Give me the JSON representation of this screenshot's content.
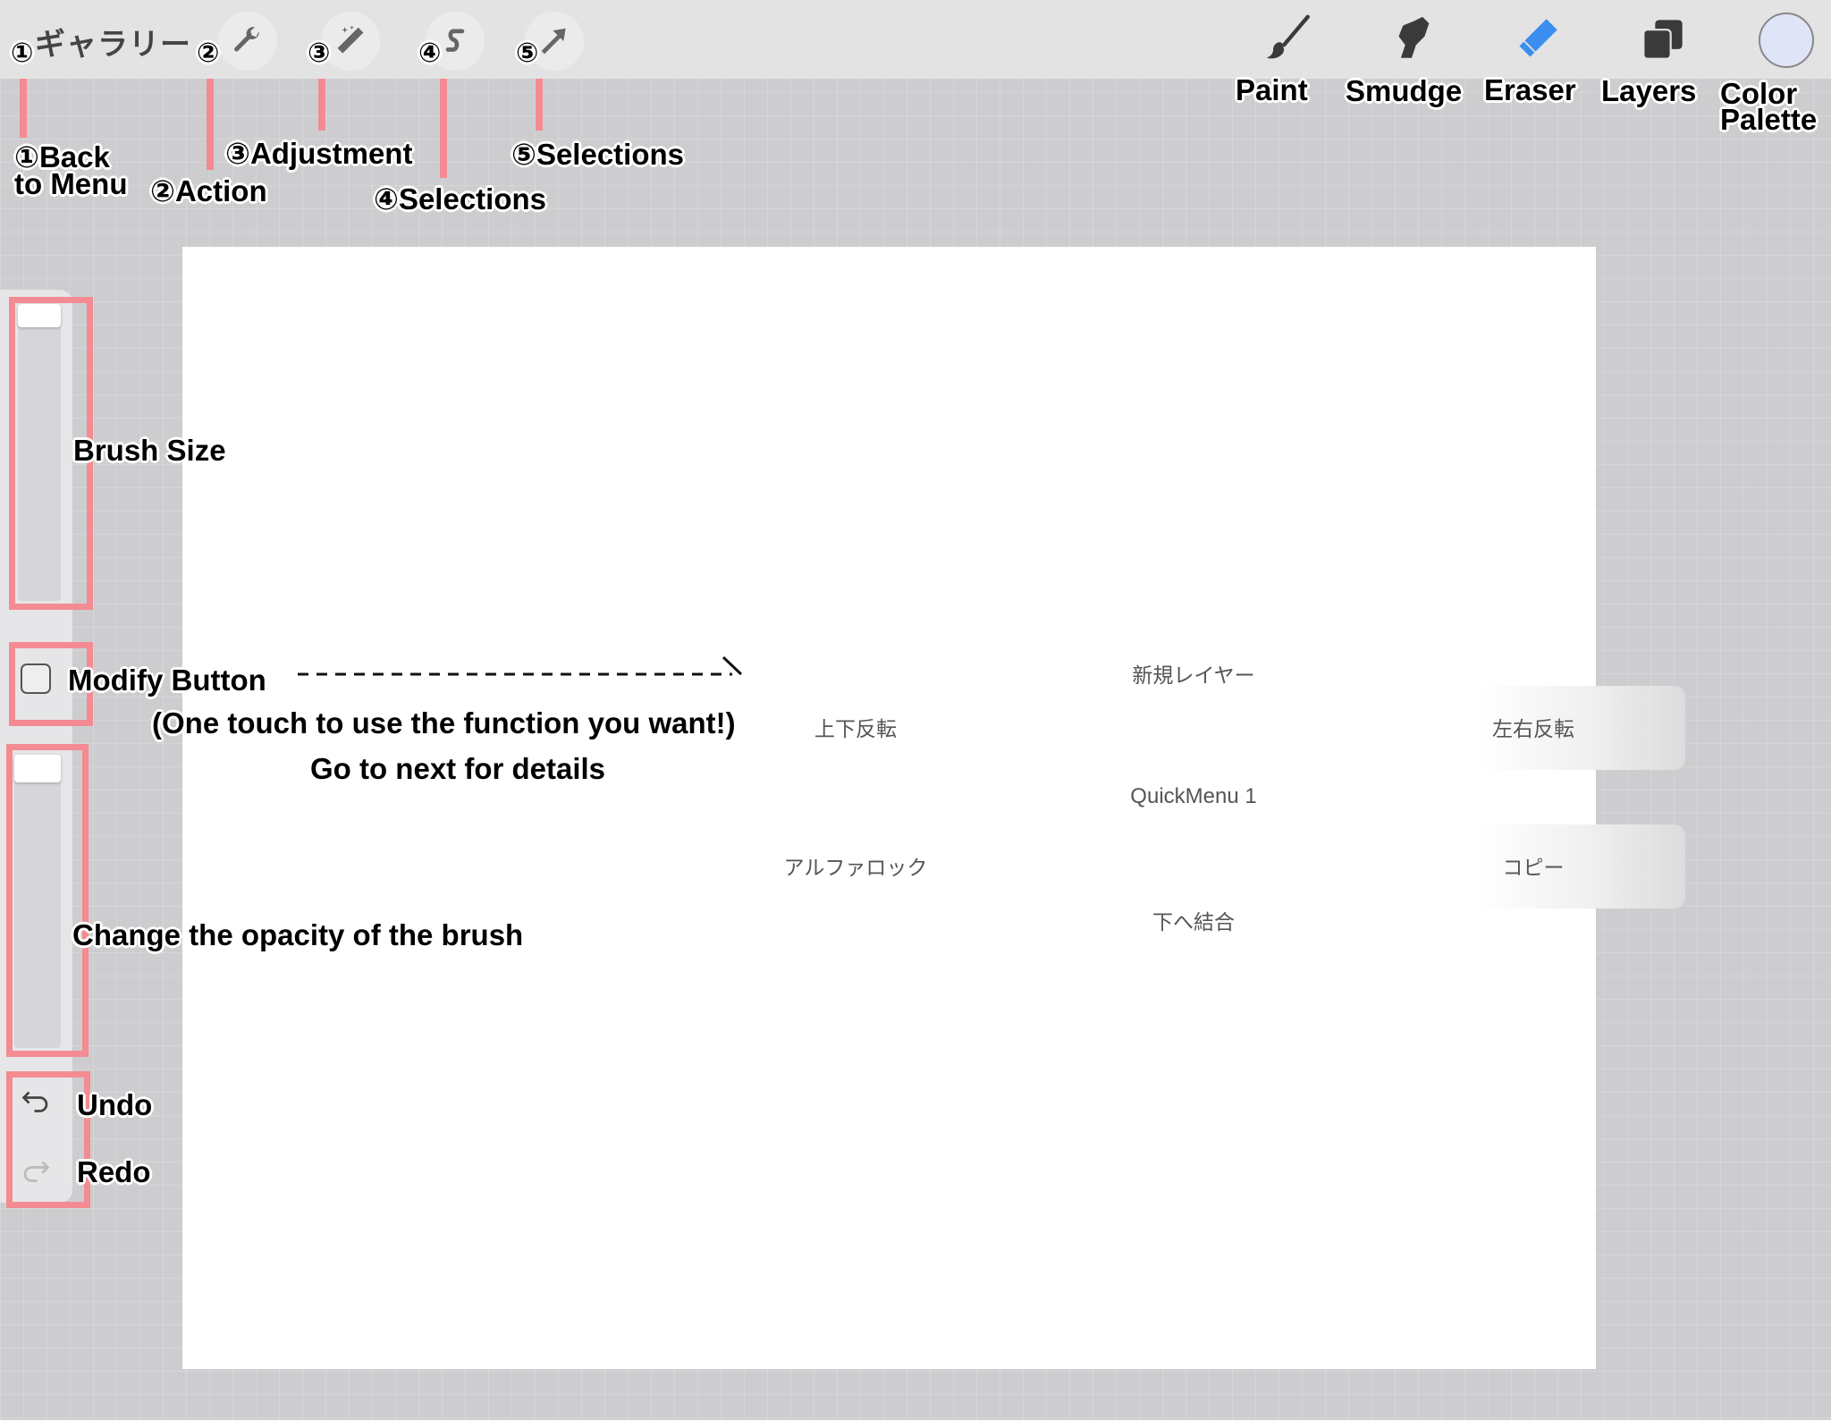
{
  "toolbar": {
    "gallery": "ギャラリー",
    "left_icons": [
      "wrench-icon",
      "magic-wand-icon",
      "selection-s-icon",
      "arrow-icon"
    ],
    "right_tools": [
      {
        "icon": "brush-icon",
        "label": "Paint"
      },
      {
        "icon": "smudge-finger-icon",
        "label": "Smudge"
      },
      {
        "icon": "eraser-icon",
        "label": "Eraser",
        "active": true
      },
      {
        "icon": "layers-icon",
        "label": "Layers"
      },
      {
        "icon": "color-circle-icon",
        "label": "Color Palette"
      }
    ],
    "color_label_line1": "Color",
    "color_label_line2": "Palette",
    "current_color": "#dfe4f7",
    "accent_color": "#3b8ef0"
  },
  "annotations": {
    "n1": "①",
    "n2": "②",
    "n3": "③",
    "n4": "④",
    "n5": "⑤",
    "back_line1": "①Back",
    "back_line2": "to Menu",
    "action": "②Action",
    "adjustment": "③Adjustment",
    "selections4": "④Selections",
    "selections5": "⑤Selections",
    "brush_size": "Brush Size",
    "modify_button": "Modify Button",
    "modify_desc": "(One touch to use the function you want!)",
    "next": "Go to next for details",
    "opacity": "Change the opacity of the brush",
    "undo": "Undo",
    "redo": "Redo",
    "highlight_color": "#f48b92"
  },
  "quickmenu": {
    "title": "QuickMenu 1",
    "top": "新規レイヤー",
    "upper_left": "上下反転",
    "upper_right": "左右反転",
    "lower_left": "アルファロック",
    "lower_right": "コピー",
    "bottom": "下へ結合"
  }
}
